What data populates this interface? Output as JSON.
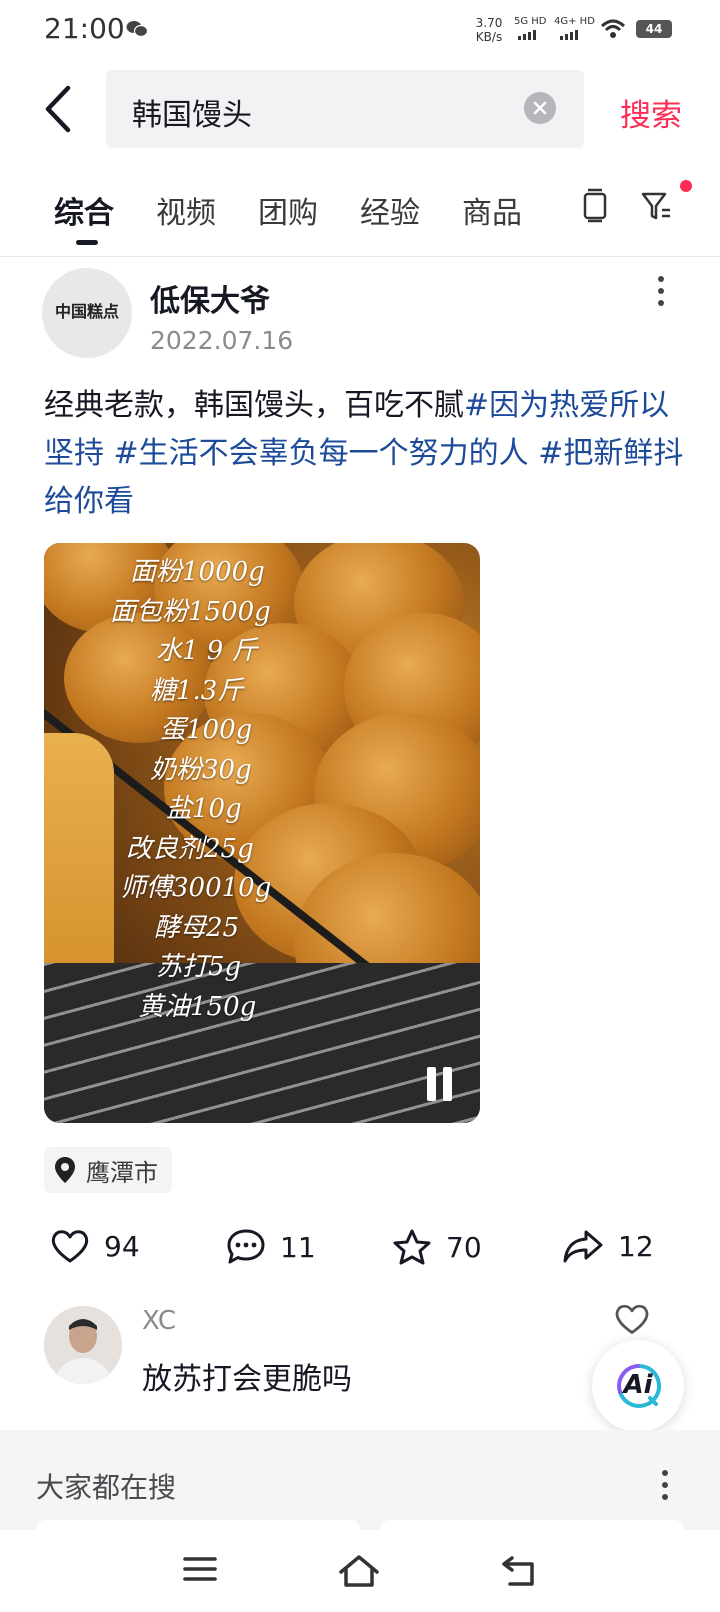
{
  "status_bar": {
    "time": "21:00",
    "speed": "3.70",
    "speed_unit": "KB/s",
    "net1": "5G HD",
    "net2": "4G+ HD",
    "battery": "44"
  },
  "search": {
    "query": "韩国馒头",
    "button_label": "搜索"
  },
  "tabs": [
    {
      "label": "综合",
      "active": true
    },
    {
      "label": "视频"
    },
    {
      "label": "团购"
    },
    {
      "label": "经验"
    },
    {
      "label": "商品"
    }
  ],
  "post": {
    "avatar_text": "中国糕点",
    "author": "低保大爷",
    "date": "2022.07.16",
    "caption_text": "经典老款，韩国馒头，百吃不腻",
    "hashtags": [
      "#因为热爱所以坚持",
      " #生活不会辜负每一个努力的人",
      " #把新鲜抖给你看"
    ],
    "recipe_lines": [
      "面粉1000g",
      "面包粉1500g",
      "水1 9 斤",
      "糖1.3斤",
      "蛋100g",
      "奶粉30g",
      "盐10g",
      "改良剂25g",
      "师傅30010g",
      "酵母25",
      "苏打5g",
      "黄油150g"
    ],
    "location": "鹰潭市",
    "likes": "94",
    "comments": "11",
    "favorites": "70",
    "shares": "12"
  },
  "comment": {
    "name": "XC",
    "text": "放苏打会更脆吗"
  },
  "ai_button": "Ai",
  "section": {
    "title": "大家都在搜"
  },
  "icons": {
    "back": "chevron-left-icon",
    "clear": "clear-icon",
    "history": "history-icon",
    "filter": "filter-icon",
    "pin": "location-pin-icon",
    "like": "heart-icon",
    "comment": "comment-icon",
    "favorite": "star-icon",
    "share": "share-icon",
    "nav_menu": "menu-icon",
    "nav_home": "home-icon",
    "nav_back": "back-icon"
  },
  "colors": {
    "accent": "#fe2c55",
    "hashtag": "#1d4b9a",
    "text": "#161823"
  }
}
